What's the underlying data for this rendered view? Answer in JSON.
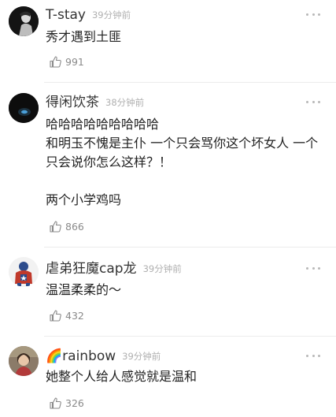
{
  "comments": [
    {
      "name": "T-stay",
      "time": "39分钟前",
      "text": "秀才遇到土匪",
      "likes": "991",
      "avatar_icon": "dark-portrait-avatar-icon"
    },
    {
      "name": "得闲饮茶",
      "time": "38分钟前",
      "text": "哈哈哈哈哈哈哈哈哈\n和明玉不愧是主仆 一个只会骂你这个坏女人 一个只会说你怎么这样？！\n\n两个小学鸡吗",
      "likes": "866",
      "avatar_icon": "dark-lamp-avatar-icon"
    },
    {
      "name": "虐弟狂魔cap龙",
      "time": "39分钟前",
      "text": "温温柔柔的～",
      "likes": "432",
      "avatar_icon": "captain-america-avatar-icon"
    },
    {
      "name": "🌈rainbow",
      "time": "39分钟前",
      "text": "她整个人给人感觉就是温和",
      "likes": "326",
      "avatar_icon": "portrait-photo-avatar-icon"
    }
  ]
}
